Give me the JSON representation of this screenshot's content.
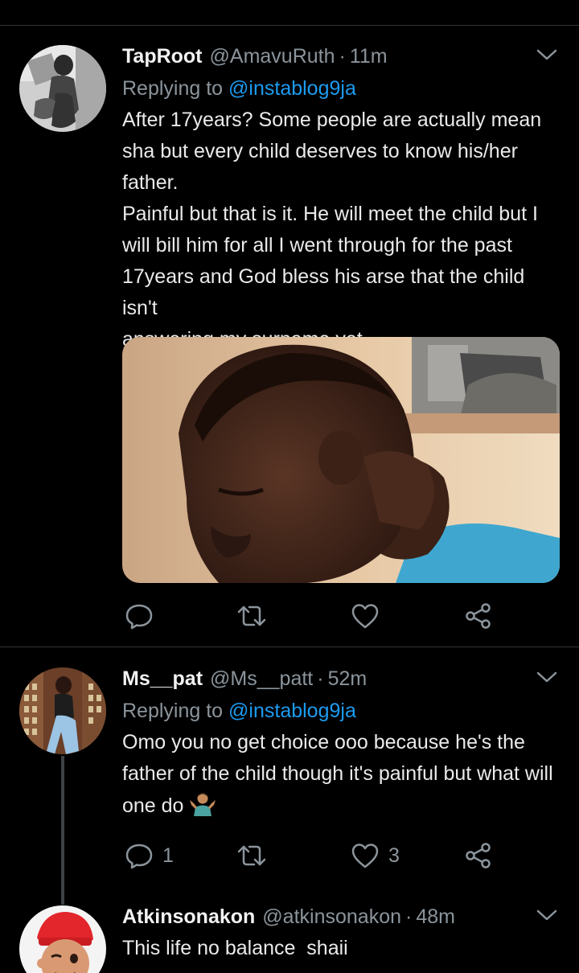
{
  "tweets": [
    {
      "name": "TapRoot",
      "handle": "@AmavuRuth",
      "dot": "·",
      "time": "11m",
      "replying_prefix": "Replying to",
      "replying_to": "@instablog9ja",
      "lines": [
        "After 17years? Some people are actually mean",
        "sha but every child deserves to know his/her",
        "father.",
        "Painful but that is it. He will meet the child but I",
        "will bill him for all I went through for the past",
        "17years and God bless his arse that the child isn't",
        "answering my surname yet."
      ],
      "reply_count": "",
      "like_count": ""
    },
    {
      "name": "Ms__pat",
      "handle": "@Ms__patt",
      "dot": "·",
      "time": "52m",
      "replying_prefix": "Replying to",
      "replying_to": "@instablog9ja",
      "lines": [
        "Omo you no get choice ooo because he's the",
        "father of the child though it's painful but what will",
        "one do"
      ],
      "reply_count": "1",
      "like_count": "3"
    },
    {
      "name": "Atkinsonakon",
      "handle": "@atkinsonakon",
      "dot": "·",
      "time": "48m",
      "lines": [
        "This life no balance  shaii"
      ]
    }
  ],
  "icons": {
    "reply": "reply-icon",
    "retweet": "retweet-icon",
    "like": "heart-icon",
    "share": "share-icon",
    "more": "chevron-down-icon"
  },
  "colors": {
    "background": "#000000",
    "link": "#1d9bf0",
    "muted": "#8b949b",
    "divider": "#2f3336"
  }
}
